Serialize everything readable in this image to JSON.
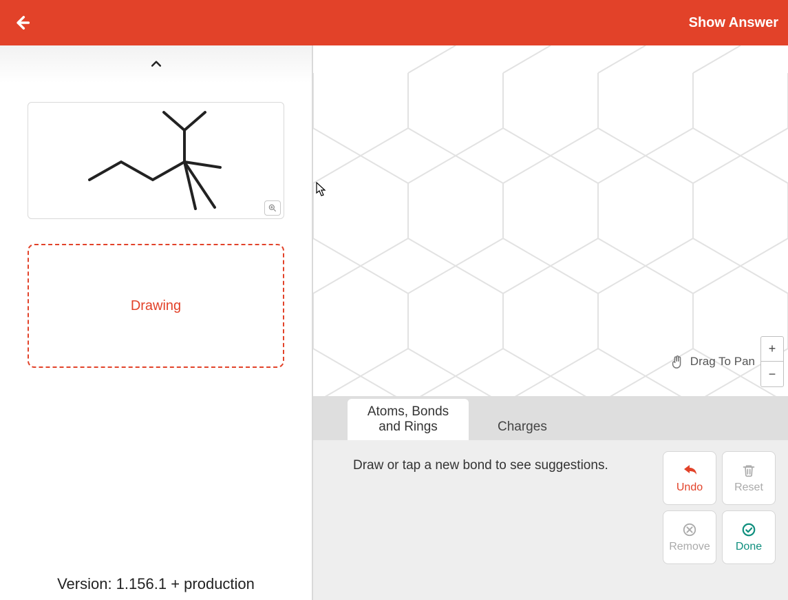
{
  "header": {
    "show_answer": "Show Answer"
  },
  "left": {
    "drawing_label": "Drawing",
    "version": "Version: 1.156.1 +  production"
  },
  "canvas": {
    "drag_hint": "Drag To Pan",
    "zoom_in": "+",
    "zoom_out": "−"
  },
  "tabs": {
    "atoms": "Atoms, Bonds and Rings",
    "charges": "Charges"
  },
  "tools": {
    "hint": "Draw or tap a new bond to see suggestions.",
    "undo": "Undo",
    "reset": "Reset",
    "remove": "Remove",
    "done": "Done"
  }
}
